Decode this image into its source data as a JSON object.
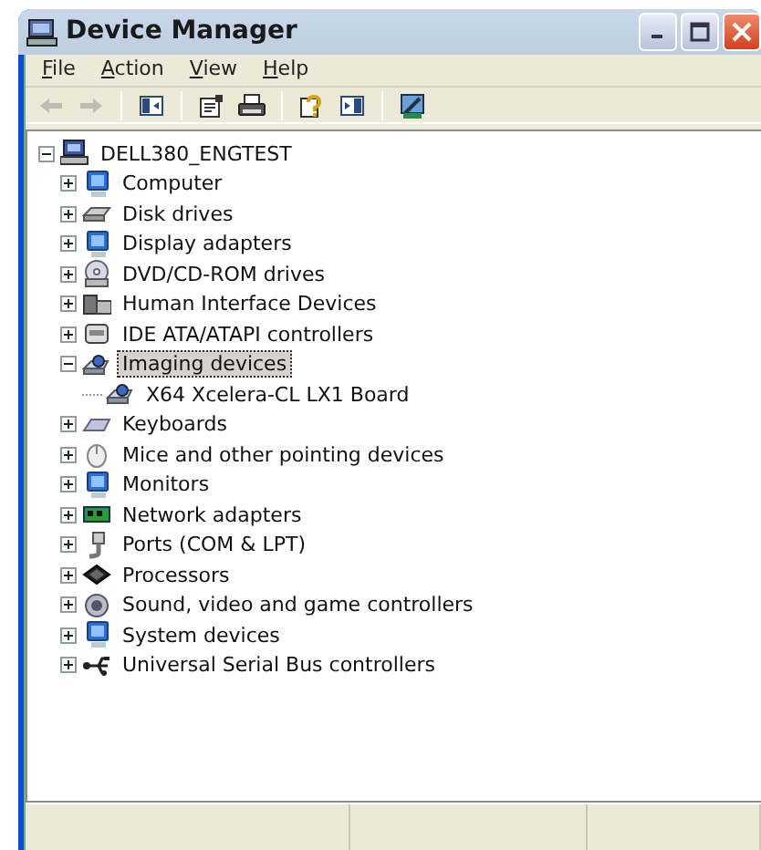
{
  "window": {
    "title": "Device Manager"
  },
  "menu": [
    {
      "label": "File"
    },
    {
      "label": "Action"
    },
    {
      "label": "View"
    },
    {
      "label": "Help"
    }
  ],
  "toolbar": [
    {
      "kind": "back",
      "disabled": true
    },
    {
      "kind": "forward",
      "disabled": true
    },
    {
      "kind": "separator"
    },
    {
      "kind": "console-tree",
      "disabled": false
    },
    {
      "kind": "separator"
    },
    {
      "kind": "properties",
      "disabled": false
    },
    {
      "kind": "print",
      "disabled": false
    },
    {
      "kind": "separator"
    },
    {
      "kind": "help",
      "disabled": false
    },
    {
      "kind": "action-pane",
      "disabled": false
    },
    {
      "kind": "separator"
    },
    {
      "kind": "scan",
      "disabled": false
    }
  ],
  "tree": [
    {
      "label": "DELL380_ENGTEST",
      "kind": "computer",
      "expanded": true,
      "selected": false,
      "children": [
        {
          "label": "Computer",
          "kind": "monitor",
          "expanded": false,
          "selected": false
        },
        {
          "label": "Disk drives",
          "kind": "disk",
          "expanded": false,
          "selected": false
        },
        {
          "label": "Display adapters",
          "kind": "monitor",
          "expanded": false,
          "selected": false
        },
        {
          "label": "DVD/CD-ROM drives",
          "kind": "cd",
          "expanded": false,
          "selected": false
        },
        {
          "label": "Human Interface Devices",
          "kind": "hid",
          "expanded": false,
          "selected": false
        },
        {
          "label": "IDE ATA/ATAPI controllers",
          "kind": "ide",
          "expanded": false,
          "selected": false
        },
        {
          "label": "Imaging devices",
          "kind": "camera",
          "expanded": true,
          "selected": true,
          "children": [
            {
              "label": "X64 Xcelera-CL LX1 Board",
              "kind": "camera",
              "selected": false
            }
          ]
        },
        {
          "label": "Keyboards",
          "kind": "keyboard",
          "expanded": false,
          "selected": false
        },
        {
          "label": "Mice and other pointing devices",
          "kind": "mouse",
          "expanded": false,
          "selected": false
        },
        {
          "label": "Monitors",
          "kind": "monitor",
          "expanded": false,
          "selected": false
        },
        {
          "label": "Network adapters",
          "kind": "network",
          "expanded": false,
          "selected": false
        },
        {
          "label": "Ports (COM & LPT)",
          "kind": "port",
          "expanded": false,
          "selected": false
        },
        {
          "label": "Processors",
          "kind": "chip",
          "expanded": false,
          "selected": false
        },
        {
          "label": "Sound, video and game controllers",
          "kind": "sound",
          "expanded": false,
          "selected": false
        },
        {
          "label": "System devices",
          "kind": "monitor",
          "expanded": false,
          "selected": false
        },
        {
          "label": "Universal Serial Bus controllers",
          "kind": "usb",
          "expanded": false,
          "selected": false
        }
      ]
    }
  ]
}
